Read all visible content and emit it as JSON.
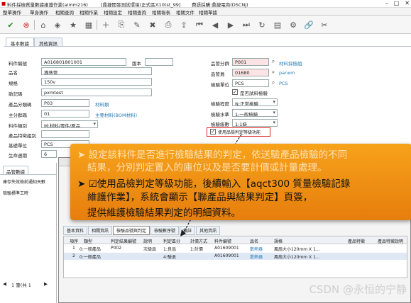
{
  "window": {
    "title": "料件採檢質量數據維護作業(aimm216)",
    "env": "[鼎捷開發測試環境(正式區)t10tst_99]",
    "login": "費語採購:鼎捷電商(DSCNJ)"
  },
  "menu": [
    "整單操作",
    "單身操作",
    "相關查詢",
    "相關作業",
    "相關設定",
    "相關查詢",
    "相關報表",
    "相關文件",
    "相關單據"
  ],
  "tabs": {
    "basic": "基本數據",
    "misc": "其他資訊"
  },
  "form": {
    "item_no_label": "料件編號",
    "item_no": "A016801801001",
    "version_label": "版本",
    "name_label": "品名",
    "name": "導熱管",
    "spec_label": "規格",
    "spec": "150v",
    "mnemonic_label": "助記碼",
    "mnemonic": "pxmtest",
    "category_label": "產品分類碼",
    "category": "P03",
    "category_link": "材料類",
    "material_type_label": "主分群碼",
    "material_type": "01",
    "material_type_link": "主要材料(BOM材料)",
    "item_type_label": "料件類別",
    "item_type": "M:材料/零件/原品",
    "feature_label": "產品特徵組別",
    "basic_unit_label": "基礎單位",
    "basic_unit": "PCS",
    "lifecycle_label": "生命週期",
    "lifecycle": "6",
    "insp_person_label": "品管分群",
    "insp_person": "P001",
    "insp_person_link": "材料採檢組",
    "inspector_label": "品管員",
    "inspector": "01680",
    "inspector_link": "panxm",
    "insp_unit_label": "檢驗單位",
    "insp_unit": "PCS",
    "insp_unit_link": "PCS",
    "is_test_item": "是否試料檢驗",
    "insp_degree_label": "檢驗程度",
    "insp_degree": "N:正常檢驗",
    "insp_level_label": "檢驗水準",
    "insp_level": "1:一般檢驗",
    "insp_grade_label": "檢驗級數",
    "insp_grade": "1:1級",
    "use_grade_check": "使用品檢判定等級功能"
  },
  "lower": {
    "section": "品管數據",
    "row1": "庫存失效檢前通知天數",
    "row2": "檢驗標準工時",
    "pager": "1 筆(共 1"
  },
  "popup": {
    "tabs": [
      "基本資料",
      "相關資訊",
      "檢驗品號與判定",
      "檢驗數序號",
      "備註",
      "其他資訊"
    ],
    "columns": [
      "項序",
      "類型",
      "判定結果編號",
      "說明",
      "判定區分",
      "計價方式",
      "料件編號",
      "品名",
      "規格",
      "產品特徵",
      "產品特徵說明"
    ],
    "rows": [
      [
        "1",
        "0:一般產品",
        "P002",
        "次級品",
        "1:良品",
        "1:計價",
        "A01609001",
        "散熱器",
        "風扇大小120mm X 1...",
        "",
        ""
      ],
      [
        "2",
        "0:一般產品",
        "",
        "",
        "4:驗退",
        "",
        "A01609001",
        "散熱器",
        "風扇大小120mm X 1...",
        "",
        ""
      ]
    ]
  },
  "callout": {
    "line1": "➤ 設定該料件是否進行檢驗結果的判定，依送驗產品檢驗的不同",
    "line2": "結果，分別判定置入的庫位以及是否要計價或計量處理。",
    "line3": "➤ ☑使用品檢判定等級功能，後續輸入【aqct300 質量檢驗記錄",
    "line4": "維護作業】，系統會顯示【聯產品與結果判定】頁簽，",
    "line5": "提供維護檢驗結果判定的明細資料。"
  },
  "watermark": "CSDN @永恒的宁静"
}
